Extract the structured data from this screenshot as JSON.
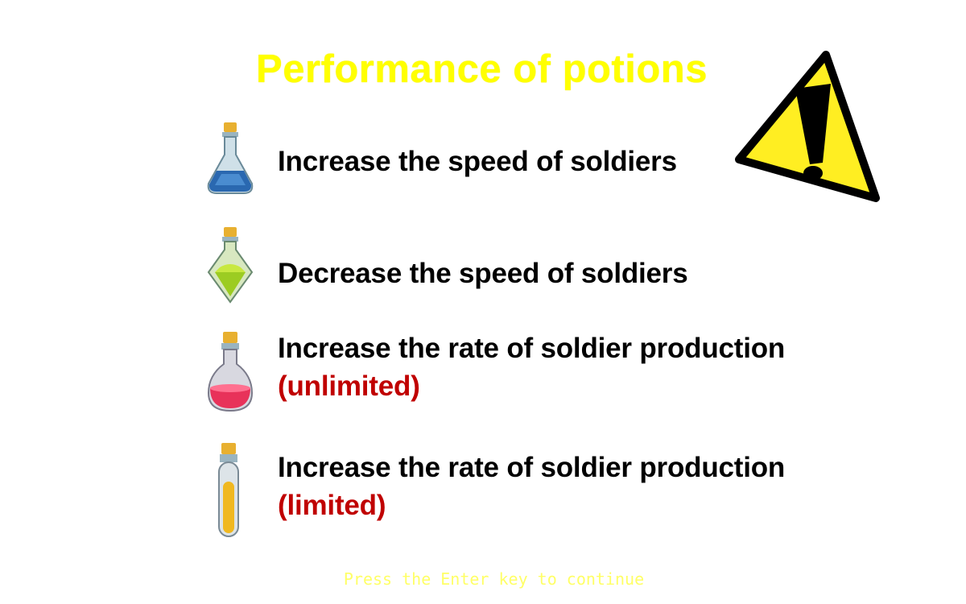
{
  "screen": {
    "title": "Performance of potions",
    "footer": "Press the Enter key to continue",
    "warning_icon": "warning-triangle-icon",
    "colors": {
      "title": "#ffff00",
      "text": "#000000",
      "note": "#c00000",
      "footer": "#ffff66"
    }
  },
  "potions": [
    {
      "icon": "blue-flask-potion-icon",
      "text": "Increase the speed of soldiers",
      "note": ""
    },
    {
      "icon": "green-diamond-potion-icon",
      "text": "Decrease the speed of soldiers",
      "note": ""
    },
    {
      "icon": "red-round-potion-icon",
      "text": "Increase the rate of soldier production",
      "note": "(unlimited)"
    },
    {
      "icon": "yellow-tube-potion-icon",
      "text": "Increase the rate of soldier production",
      "note": "(limited)"
    }
  ]
}
